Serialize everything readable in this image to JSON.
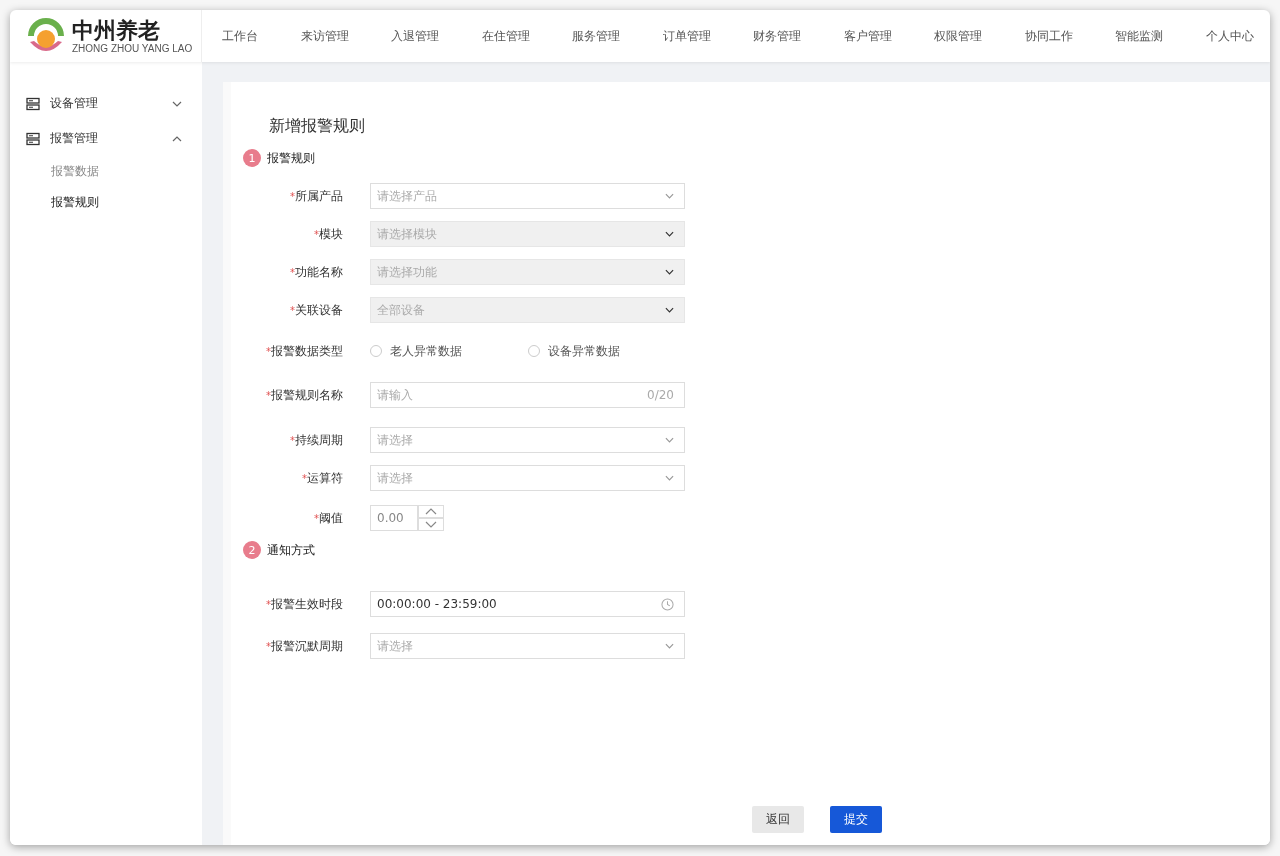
{
  "logo": {
    "name": "中州养老",
    "subtitle": "ZHONG ZHOU YANG LAO"
  },
  "nav": [
    "工作台",
    "来访管理",
    "入退管理",
    "在住管理",
    "服务管理",
    "订单管理",
    "财务管理",
    "客户管理",
    "权限管理",
    "协同工作",
    "智能监测",
    "个人中心"
  ],
  "sidebar": [
    {
      "label": "设备管理",
      "expanded": false
    },
    {
      "label": "报警管理",
      "expanded": true,
      "children": [
        {
          "label": "报警数据",
          "selected": false
        },
        {
          "label": "报警规则",
          "selected": true
        }
      ]
    }
  ],
  "page_title": "新增报警规则",
  "sections": [
    {
      "number": "1",
      "title": "报警规则",
      "fields": [
        {
          "kind": "select",
          "required_mark": "*",
          "label": "所属产品",
          "placeholder": "请选择产品",
          "disabled": false
        },
        {
          "kind": "select",
          "required_mark": "*",
          "label": "模块",
          "placeholder": "请选择模块",
          "disabled": true
        },
        {
          "kind": "select",
          "required_mark": "*",
          "label": "功能名称",
          "placeholder": "请选择功能",
          "disabled": true
        },
        {
          "kind": "select",
          "required_mark": "*",
          "label": "关联设备",
          "placeholder": "全部设备",
          "disabled": true
        },
        {
          "kind": "radio",
          "required_mark": "*",
          "label": "报警数据类型",
          "options": [
            {
              "label": "老人异常数据",
              "selected": false
            },
            {
              "label": "设备异常数据",
              "selected": false
            }
          ]
        },
        {
          "kind": "text",
          "required_mark": "*",
          "label": "报警规则名称",
          "placeholder": "请输入",
          "counter": "0/20"
        },
        {
          "kind": "select",
          "required_mark": "*",
          "label": "持续周期",
          "placeholder": "请选择",
          "disabled": false
        },
        {
          "kind": "select",
          "required_mark": "*",
          "label": "运算符",
          "placeholder": "请选择",
          "disabled": false
        },
        {
          "kind": "number",
          "required_mark": "*",
          "label": "阈值",
          "value": "0.00"
        }
      ]
    },
    {
      "number": "2",
      "title": "通知方式",
      "fields": [
        {
          "kind": "time",
          "required_mark": "*",
          "label": "报警生效时段",
          "value": "00:00:00 - 23:59:00"
        },
        {
          "kind": "select",
          "required_mark": "*",
          "label": "报警沉默周期",
          "placeholder": "请选择",
          "disabled": false
        }
      ]
    }
  ],
  "buttons": [
    {
      "label": "返回",
      "kind": "secondary"
    },
    {
      "label": "提交",
      "kind": "primary"
    }
  ]
}
